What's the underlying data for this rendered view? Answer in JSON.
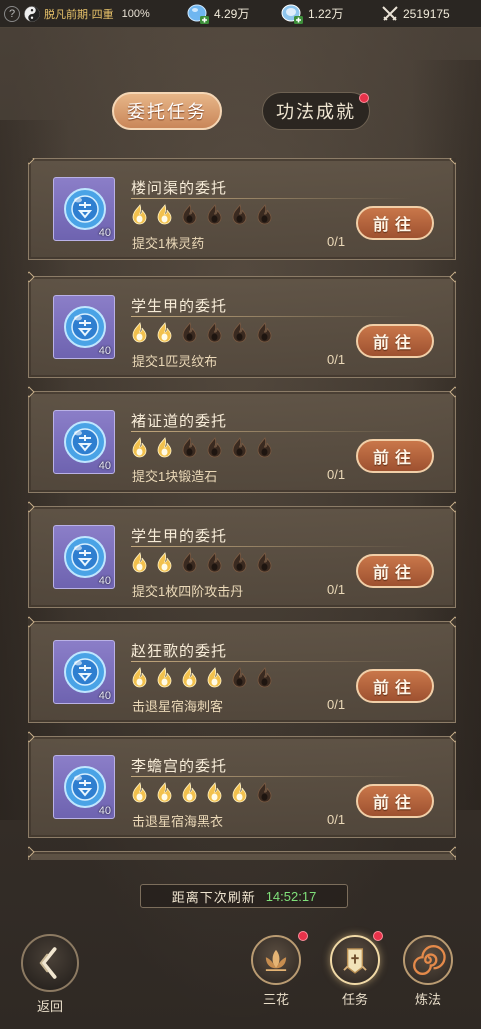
{
  "status_bar": {
    "help_icon": "question-mark",
    "realm_label": "脱凡前期·四重",
    "realm_percent": "100%",
    "currencies": [
      {
        "icon": "blue-gem-plus-icon",
        "value": "4.29万"
      },
      {
        "icon": "white-gem-plus-icon",
        "value": "1.22万"
      },
      {
        "icon": "crossed-swords-icon",
        "value": "2519175"
      }
    ]
  },
  "tabs": [
    {
      "label": "委托任务",
      "active": true
    },
    {
      "label": "功法成就",
      "active": false,
      "badge": true
    }
  ],
  "tasks": [
    {
      "title": "楼问渠的委托",
      "lit": 2,
      "total": 6,
      "desc": "提交1株灵药",
      "progress": "0/1",
      "level": "40",
      "button": "前往"
    },
    {
      "title": "学生甲的委托",
      "lit": 2,
      "total": 6,
      "desc": "提交1匹灵纹布",
      "progress": "0/1",
      "level": "40",
      "button": "前往"
    },
    {
      "title": "褚证道的委托",
      "lit": 2,
      "total": 6,
      "desc": "提交1块锻造石",
      "progress": "0/1",
      "level": "40",
      "button": "前往"
    },
    {
      "title": "学生甲的委托",
      "lit": 2,
      "total": 6,
      "desc": "提交1枚四阶攻击丹",
      "progress": "0/1",
      "level": "40",
      "button": "前往"
    },
    {
      "title": "赵狂歌的委托",
      "lit": 4,
      "total": 6,
      "desc": "击退星宿海刺客",
      "progress": "0/1",
      "level": "40",
      "button": "前往"
    },
    {
      "title": "李蟾宫的委托",
      "lit": 5,
      "total": 6,
      "desc": "击退星宿海黑衣",
      "progress": "0/1",
      "level": "40",
      "button": "前往"
    }
  ],
  "refresh": {
    "label": "距离下次刷新",
    "time": "14:52:17"
  },
  "nav": {
    "back": {
      "label": "返回",
      "icon": "back-arrow-icon"
    },
    "items": [
      {
        "label": "三花",
        "icon": "lotus-icon",
        "badge": true
      },
      {
        "label": "任务",
        "icon": "scroll-banner-icon",
        "badge": true,
        "active": true
      },
      {
        "label": "炼法",
        "icon": "spiral-icon",
        "badge": false
      }
    ]
  },
  "colors": {
    "accent_button": "#b8663d",
    "timer_green": "#7fe07a",
    "badge_red": "#e8324a",
    "flame_lit": "#f2c14e",
    "flame_unlit": "#3a2a20"
  }
}
